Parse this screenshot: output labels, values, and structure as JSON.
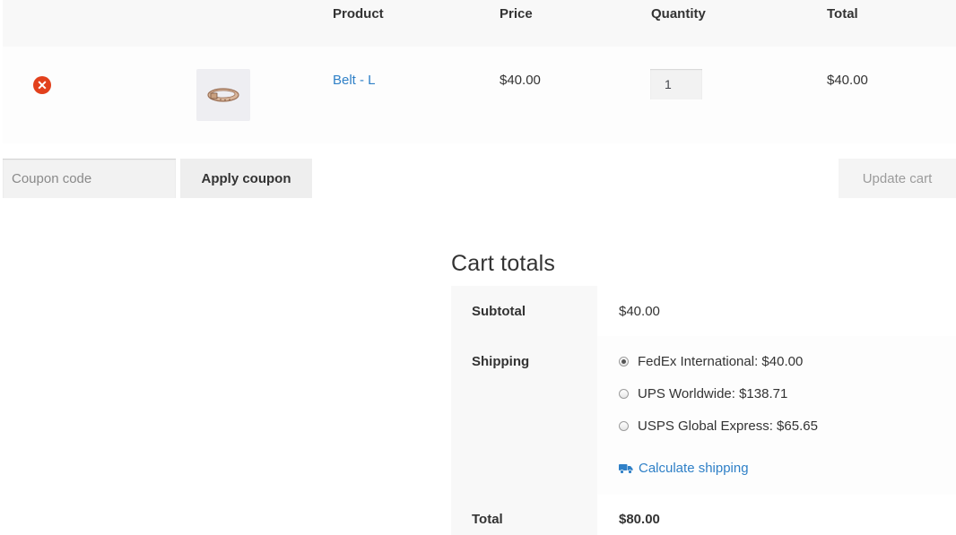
{
  "cart": {
    "headers": {
      "product": "Product",
      "price": "Price",
      "quantity": "Quantity",
      "total": "Total"
    },
    "items": [
      {
        "remove_icon": "remove-icon",
        "remove_glyph": "✕",
        "thumbnail_icon": "belt-thumbnail",
        "name": "Belt - L",
        "price": "$40.00",
        "quantity": "1",
        "total": "$40.00"
      }
    ]
  },
  "actions": {
    "coupon_placeholder": "Coupon code",
    "coupon_value": "",
    "apply_label": "Apply coupon",
    "update_label": "Update cart"
  },
  "totals": {
    "title": "Cart totals",
    "subtotal_label": "Subtotal",
    "subtotal_value": "$40.00",
    "shipping_label": "Shipping",
    "shipping_options": [
      {
        "label": "FedEx International: $40.00",
        "selected": true
      },
      {
        "label": "UPS Worldwide: $138.71",
        "selected": false
      },
      {
        "label": "USPS Global Express: $65.65",
        "selected": false
      }
    ],
    "calculate_shipping_label": "Calculate shipping",
    "calculate_shipping_icon": "truck-icon",
    "total_label": "Total",
    "total_value": "$80.00"
  },
  "colors": {
    "accent_link": "#2f80c7",
    "remove_red": "#e2401c",
    "row_bg": "#f8f8f8"
  }
}
